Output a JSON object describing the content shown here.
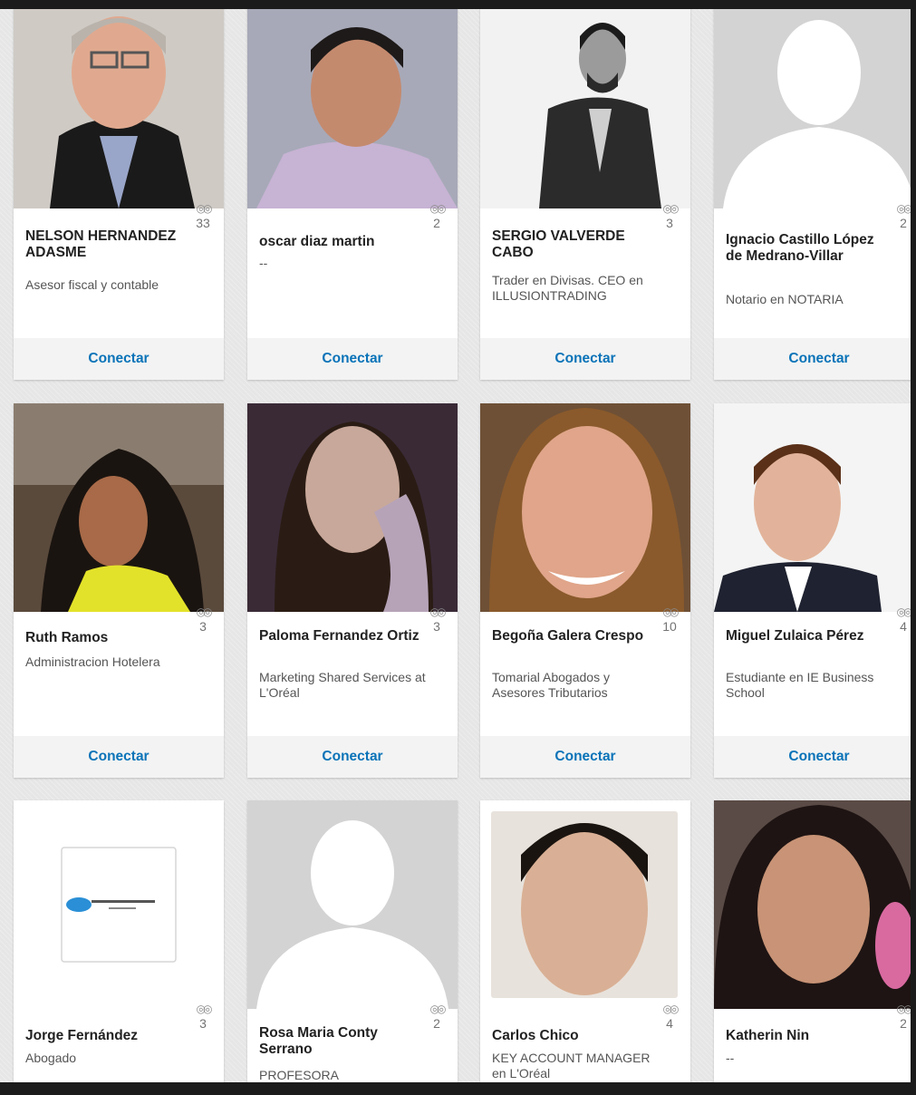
{
  "cards": [
    {
      "name": "NELSON HERNANDEZ ADASME",
      "headline": "Asesor fiscal y contable",
      "connections": "33",
      "action": "Conectar"
    },
    {
      "name": "oscar diaz martin",
      "headline": "--",
      "connections": "2",
      "action": "Conectar"
    },
    {
      "name": "SERGIO VALVERDE CABO",
      "headline": "Trader en Divisas. CEO en ILLUSIONTRADING",
      "connections": "3",
      "action": "Conectar"
    },
    {
      "name": "Ignacio Castillo López de Medrano-Villar",
      "headline": "Notario en NOTARIA",
      "connections": "2",
      "action": "Conectar"
    },
    {
      "name": "Ruth Ramos",
      "headline": "Administracion Hotelera",
      "connections": "3",
      "action": "Conectar"
    },
    {
      "name": "Paloma Fernandez Ortiz",
      "headline": "Marketing Shared Services at L'Oréal",
      "connections": "3",
      "action": "Conectar"
    },
    {
      "name": "Begoña Galera Crespo",
      "headline": "Tomarial Abogados y Asesores Tributarios",
      "connections": "10",
      "action": "Conectar"
    },
    {
      "name": "Miguel Zulaica Pérez",
      "headline": "Estudiante en IE Business School",
      "connections": "4",
      "action": "Conectar"
    },
    {
      "name": "Jorge Fernández",
      "headline": "Abogado",
      "connections": "3",
      "logo_text": "Jorge Fernández Liébana",
      "logo_sub": "Abogado"
    },
    {
      "name": "Rosa Maria Conty Serrano",
      "headline": "PROFESORA",
      "connections": "2"
    },
    {
      "name": "Carlos Chico",
      "headline": "KEY ACCOUNT MANAGER en L'Oréal",
      "connections": "4"
    },
    {
      "name": "Katherin Nin",
      "headline": "--",
      "connections": "2"
    }
  ],
  "icons": {
    "connection": "shared-connections-icon"
  },
  "colors": {
    "link": "#0a73b8",
    "background": "#e6e6e6"
  }
}
